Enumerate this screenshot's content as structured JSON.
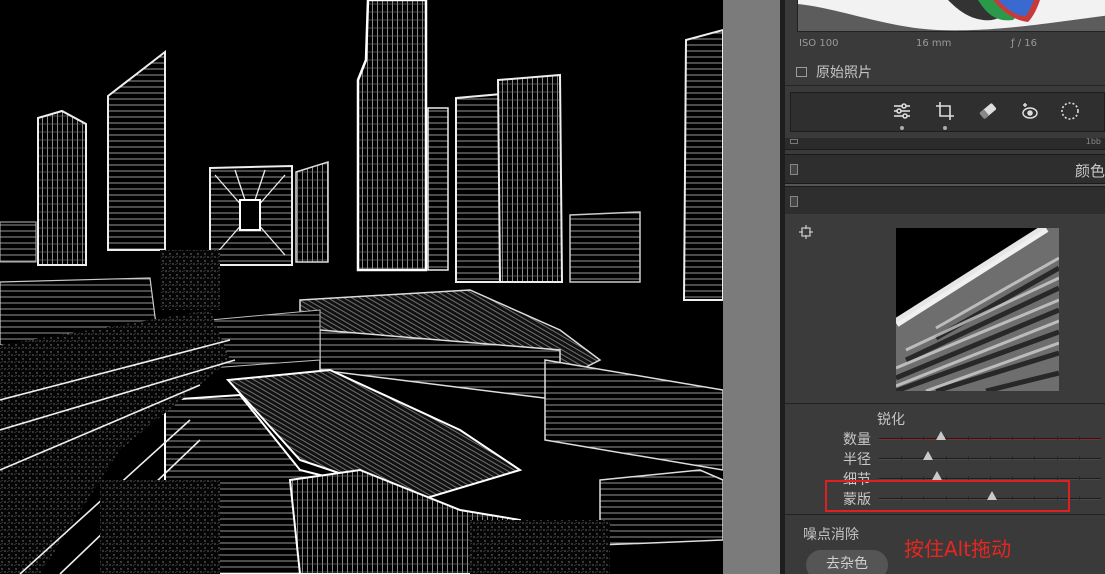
{
  "exif": {
    "iso": "ISO 100",
    "focal": "16 mm",
    "aperture": "ƒ / 16"
  },
  "original_photo": {
    "label": "原始照片",
    "checked": false
  },
  "tools": [
    {
      "name": "sliders-icon"
    },
    {
      "name": "crop-icon"
    },
    {
      "name": "eraser-icon"
    },
    {
      "name": "redeye-icon"
    },
    {
      "name": "radial-icon"
    }
  ],
  "thin_bar": {
    "value": "1bb"
  },
  "sections": {
    "color": "颜色"
  },
  "sharpen": {
    "title": "锐化",
    "sliders": [
      {
        "label": "数量",
        "value": 0.28
      },
      {
        "label": "半径",
        "value": 0.22
      },
      {
        "label": "细节",
        "value": 0.26
      },
      {
        "label": "蒙版",
        "value": 0.51
      }
    ]
  },
  "noise": {
    "title": "噪点消除",
    "button": "去杂色"
  },
  "annotation": "按住Alt拖动",
  "colors": {
    "annotation": "#e8261f",
    "panel": "#3a3a3a",
    "accent_red_line": "#8a2a2a"
  }
}
